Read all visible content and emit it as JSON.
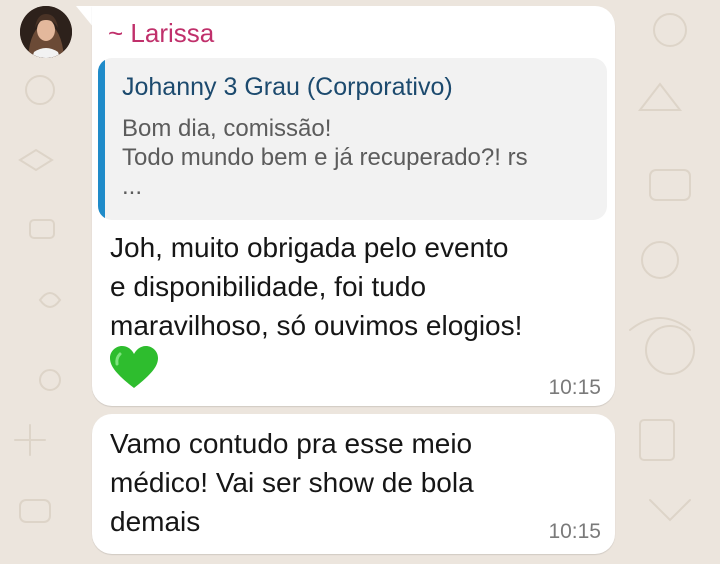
{
  "chat": {
    "sender_name": "~ Larissa",
    "avatar_icon": "profile-photo-woman",
    "quoted": {
      "author": "Johanny 3 Grau (Corporativo)",
      "line1": "Bom dia, comissão!",
      "line2": "Todo mundo bem e já recuperado?! rs",
      "line3": "..."
    },
    "messages": [
      {
        "text": "Joh, muito obrigada pelo evento\ne disponibilidade, foi tudo\nmaravilhoso, só ouvimos elogios!",
        "emoji_icon": "green-heart-icon",
        "time": "10:15"
      },
      {
        "text": "Vamo contudo pra esse meio\nmédico! Vai ser show de bola\ndemais",
        "time": "10:15"
      }
    ]
  },
  "colors": {
    "background": "#ece5dd",
    "sender": "#c0306b",
    "quote_bar": "#1f8bc9",
    "quote_author": "#1c4a6e"
  }
}
